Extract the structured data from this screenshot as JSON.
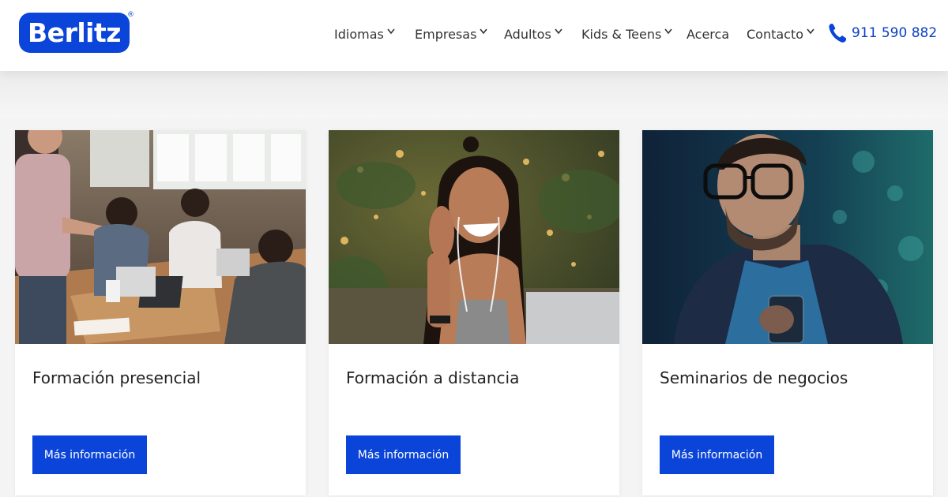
{
  "brand": {
    "logo_text": "Berlitz",
    "registered_mark": "®",
    "color": "#0a44d9"
  },
  "nav": {
    "items": [
      {
        "label": "Idiomas",
        "has_dropdown": true
      },
      {
        "label": "Empresas",
        "has_dropdown": true
      },
      {
        "label": "Adultos",
        "has_dropdown": true
      },
      {
        "label": "Kids & Teens",
        "has_dropdown": true
      },
      {
        "label": "Acerca",
        "has_dropdown": false
      },
      {
        "label": "Contacto",
        "has_dropdown": true
      }
    ],
    "phone": "911 590 882",
    "phone_icon": "phone-icon"
  },
  "cards": [
    {
      "title": "Formación presencial",
      "button_label": "Más información",
      "image": "office-meeting-photo"
    },
    {
      "title": "Formación a distancia",
      "button_label": "Más información",
      "image": "video-call-woman-photo"
    },
    {
      "title": "Seminarios de negocios",
      "button_label": "Más información",
      "image": "businessman-phone-photo"
    }
  ],
  "colors": {
    "accent": "#0a44d9",
    "phone_text": "#0a3fc4",
    "button": "#0a44d9",
    "title_text": "#222222"
  }
}
